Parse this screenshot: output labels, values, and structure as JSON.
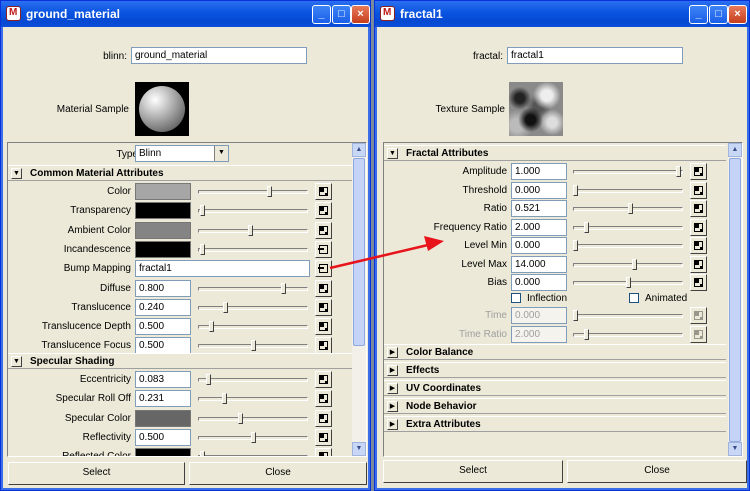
{
  "left_window": {
    "title": "ground_material",
    "node_type_label": "blinn:",
    "node_name": "ground_material",
    "sample_label": "Material Sample",
    "type_label": "Type",
    "type_value": "Blinn",
    "common_section": "Common Material Attributes",
    "attrs": [
      {
        "label": "Color",
        "kind": "swatch",
        "color": "#a6a6a6",
        "slider": 0.66
      },
      {
        "label": "Transparency",
        "kind": "swatch",
        "color": "#000000",
        "slider": 0.02
      },
      {
        "label": "Ambient Color",
        "kind": "swatch",
        "color": "#848484",
        "slider": 0.48
      },
      {
        "label": "Incandescence",
        "kind": "swatch",
        "color": "#000000",
        "slider": 0.02,
        "connected": true
      },
      {
        "label": "Bump Mapping",
        "kind": "text",
        "value": "fractal1",
        "connected": true
      },
      {
        "label": "Diffuse",
        "kind": "number",
        "value": "0.800",
        "slider": 0.79
      },
      {
        "label": "Translucence",
        "kind": "number",
        "value": "0.240",
        "slider": 0.24
      },
      {
        "label": "Translucence Depth",
        "kind": "number",
        "value": "0.500",
        "slider": 0.1
      },
      {
        "label": "Translucence Focus",
        "kind": "number",
        "value": "0.500",
        "slider": 0.5
      }
    ],
    "specular_section": "Specular Shading",
    "spec_attrs": [
      {
        "label": "Eccentricity",
        "kind": "number",
        "value": "0.083",
        "slider": 0.08
      },
      {
        "label": "Specular Roll Off",
        "kind": "number",
        "value": "0.231",
        "slider": 0.23
      },
      {
        "label": "Specular Color",
        "kind": "swatch",
        "color": "#666666",
        "slider": 0.38
      },
      {
        "label": "Reflectivity",
        "kind": "number",
        "value": "0.500",
        "slider": 0.5
      },
      {
        "label": "Reflected Color",
        "kind": "swatch",
        "color": "#000000",
        "slider": 0.02
      }
    ],
    "select_label": "Select",
    "close_label": "Close"
  },
  "right_window": {
    "title": "fractal1",
    "node_type_label": "fractal:",
    "node_name": "fractal1",
    "sample_label": "Texture Sample",
    "fractal_section": "Fractal Attributes",
    "attrs": [
      {
        "label": "Amplitude",
        "value": "1.000",
        "slider": 0.98
      },
      {
        "label": "Threshold",
        "value": "0.000",
        "slider": 0.0
      },
      {
        "label": "Ratio",
        "value": "0.521",
        "slider": 0.52
      },
      {
        "label": "Frequency Ratio",
        "value": "2.000",
        "slider": 0.1
      },
      {
        "label": "Level Min",
        "value": "0.000",
        "slider": 0.0
      },
      {
        "label": "Level Max",
        "value": "14.000",
        "slider": 0.56
      },
      {
        "label": "Bias",
        "value": "0.000",
        "slider": 0.5
      }
    ],
    "inflection_label": "Inflection",
    "animated_label": "Animated",
    "disabled_attrs": [
      {
        "label": "Time",
        "value": "0.000",
        "slider": 0.0
      },
      {
        "label": "Time Ratio",
        "value": "2.000",
        "slider": 0.1
      }
    ],
    "collapsed_sections": [
      "Color Balance",
      "Effects",
      "UV Coordinates",
      "Node Behavior",
      "Extra Attributes"
    ],
    "select_label": "Select",
    "close_label": "Close"
  },
  "colors": {
    "title_bar": "#0a54e0",
    "connection_arrow": "#e8141c"
  }
}
